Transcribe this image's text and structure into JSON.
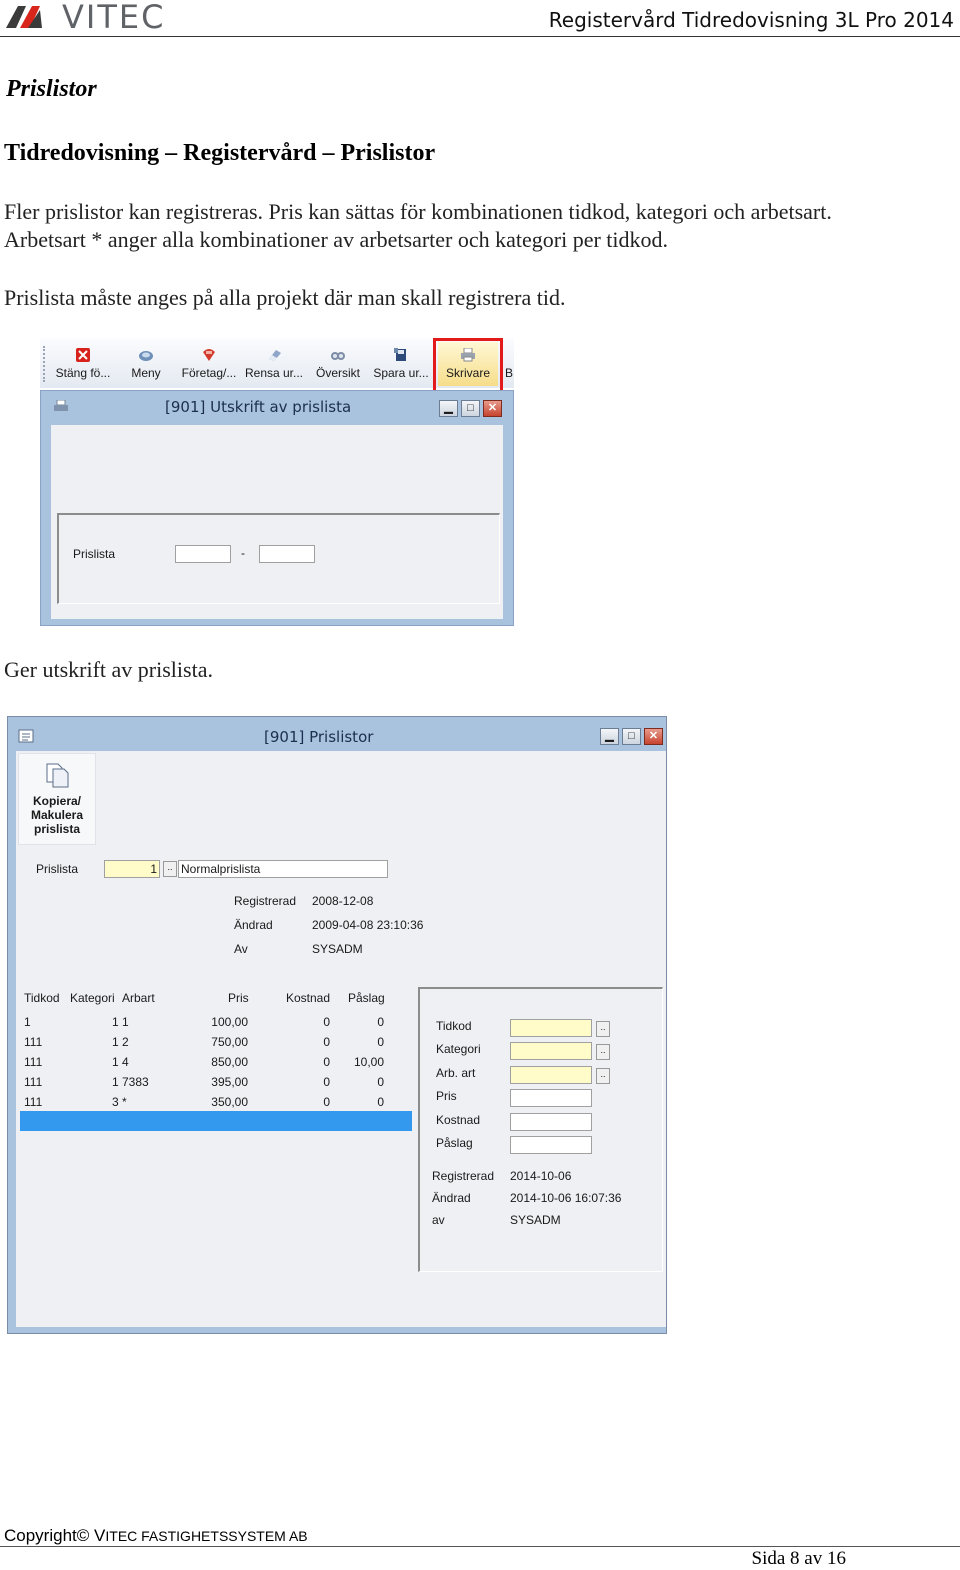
{
  "header": {
    "logo_text": "VITEC",
    "doc_title": "Registervård Tidredovisning 3L Pro 2014"
  },
  "section_title": "Prislistor",
  "sub_title": "Tidredovisning – Registervård – Prislistor",
  "paragraphs": [
    "Fler prislistor kan registreras. Pris kan sättas för kombinationen tidkod, kategori och arbetsart.",
    "Arbetsart * anger alla kombinationer av arbetsarter och kategori per tidkod.",
    "Prislista måste anges på alla projekt där man skall registrera tid."
  ],
  "screenshot1": {
    "toolbar": [
      {
        "label": "Stäng fö...",
        "icon": "close-red-icon"
      },
      {
        "label": "Meny",
        "icon": "menu-icon"
      },
      {
        "label": "Företag/...",
        "icon": "company-icon"
      },
      {
        "label": "Rensa ur...",
        "icon": "eraser-icon"
      },
      {
        "label": "Översikt",
        "icon": "overview-icon"
      },
      {
        "label": "Spara ur...",
        "icon": "save-icon"
      },
      {
        "label": "Skrivare",
        "icon": "printer-icon"
      },
      {
        "label": "B",
        "icon": ""
      }
    ],
    "window_title": "[901]  Utskrift av prislista",
    "field_label": "Prislista",
    "range_separator": "-"
  },
  "caption1": "Ger utskrift av prislista.",
  "screenshot2": {
    "window_title": "[901]  Prislistor",
    "copy_button": "Kopiera/ Makulera prislista",
    "prislista_label": "Prislista",
    "prislista_value": "1",
    "prislista_name": "Normalprislista",
    "meta": [
      {
        "label": "Registrerad",
        "value": "2008-12-08"
      },
      {
        "label": "Ändrad",
        "value": "2009-04-08 23:10:36"
      },
      {
        "label": "Av",
        "value": "SYSADM"
      }
    ],
    "table": {
      "headers": [
        "Tidkod",
        "Kategori",
        "Arbart",
        "Pris",
        "Kostnad",
        "Påslag"
      ],
      "rows": [
        [
          "1",
          "1 1",
          "",
          "100,00",
          "0",
          "0"
        ],
        [
          "111",
          "1 2",
          "",
          "750,00",
          "0",
          "0"
        ],
        [
          "111",
          "1 4",
          "",
          "850,00",
          "0",
          "10,00"
        ],
        [
          "111",
          "1 7383",
          "",
          "395,00",
          "0",
          "0"
        ],
        [
          "111",
          "3 *",
          "",
          "350,00",
          "0",
          "0"
        ]
      ]
    },
    "detail_fields": [
      "Tidkod",
      "Kategori",
      "Arb. art",
      "Pris",
      "Kostnad",
      "Påslag"
    ],
    "detail_meta": [
      {
        "label": "Registrerad",
        "value": "2014-10-06"
      },
      {
        "label": "Ändrad",
        "value": "2014-10-06 16:07:36"
      },
      {
        "label": "av",
        "value": "SYSADM"
      }
    ]
  },
  "footer": {
    "copyright_prefix": "Copyright©",
    "copyright_company_v": "V",
    "copyright_company_rest": "ITEC FASTIGHETSSYSTEM AB",
    "page": "Sida 8 av 16"
  }
}
